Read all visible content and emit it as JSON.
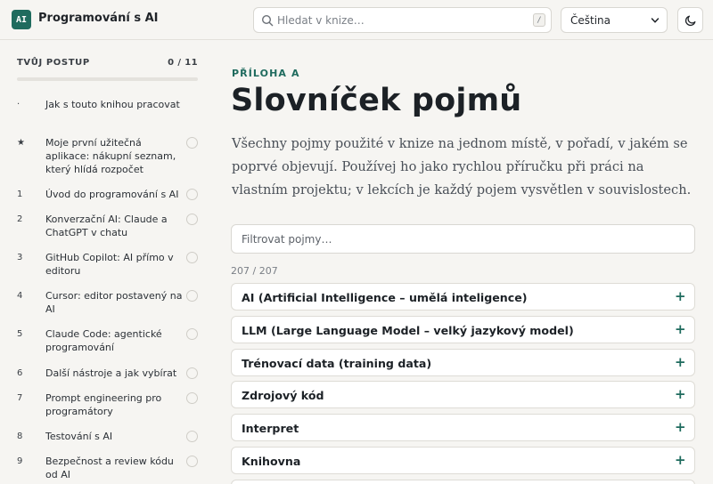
{
  "app": {
    "badge": "AI",
    "title": "Programování s AI"
  },
  "search": {
    "placeholder": "Hledat v knize…",
    "value": "",
    "shortcut": "/"
  },
  "language": {
    "selected": "Čeština"
  },
  "theme": {
    "icon": "moon-icon"
  },
  "sidebar": {
    "heading": "TVŮJ POSTUP",
    "count": "0 / 11",
    "progress_fraction": 0,
    "items": [
      {
        "num": "·",
        "label": "Jak s touto knihou pracovat",
        "checkable": false
      },
      {
        "num": "★",
        "label": "Moje první užitečná aplikace: nákupní seznam, který hlídá rozpočet",
        "checkable": true
      },
      {
        "num": "1",
        "label": "Úvod do programování s AI",
        "checkable": true
      },
      {
        "num": "2",
        "label": "Konverzační AI: Claude a ChatGPT v chatu",
        "checkable": true
      },
      {
        "num": "3",
        "label": "GitHub Copilot: AI přímo v editoru",
        "checkable": true
      },
      {
        "num": "4",
        "label": "Cursor: editor postavený na AI",
        "checkable": true
      },
      {
        "num": "5",
        "label": "Claude Code: agentické programování",
        "checkable": true
      },
      {
        "num": "6",
        "label": "Další nástroje a jak vybírat",
        "checkable": true
      },
      {
        "num": "7",
        "label": "Prompt engineering pro programátory",
        "checkable": true
      },
      {
        "num": "8",
        "label": "Testování s AI",
        "checkable": true
      },
      {
        "num": "9",
        "label": "Bezpečnost a review kódu od AI",
        "checkable": true
      }
    ]
  },
  "main": {
    "eyebrow": "PŘÍLOHA A",
    "title": "Slovníček pojmů",
    "lead": "Všechny pojmy použité v knize na jednom místě, v pořadí, v jakém se poprvé objevují. Používej ho jako rychlou příručku při práci na vlastním projektu; v lekcích je každý pojem vysvětlen v souvislostech.",
    "filter_placeholder": "Filtrovat pojmy…",
    "filter_value": "",
    "result_count": "207 / 207",
    "terms": [
      {
        "name": "AI (Artificial Intelligence – umělá inteligence)",
        "toggle": "+"
      },
      {
        "name": "LLM (Large Language Model – velký jazykový model)",
        "toggle": "+"
      },
      {
        "name": "Trénovací data (training data)",
        "toggle": "+"
      },
      {
        "name": "Zdrojový kód",
        "toggle": "+"
      },
      {
        "name": "Interpret",
        "toggle": "+"
      },
      {
        "name": "Knihovna",
        "toggle": "+"
      }
    ]
  },
  "colors": {
    "accent": "#1f6b5e",
    "background": "#f6f5f2",
    "surface": "#ffffff",
    "text": "#1c2126",
    "muted": "#7a7f86"
  }
}
